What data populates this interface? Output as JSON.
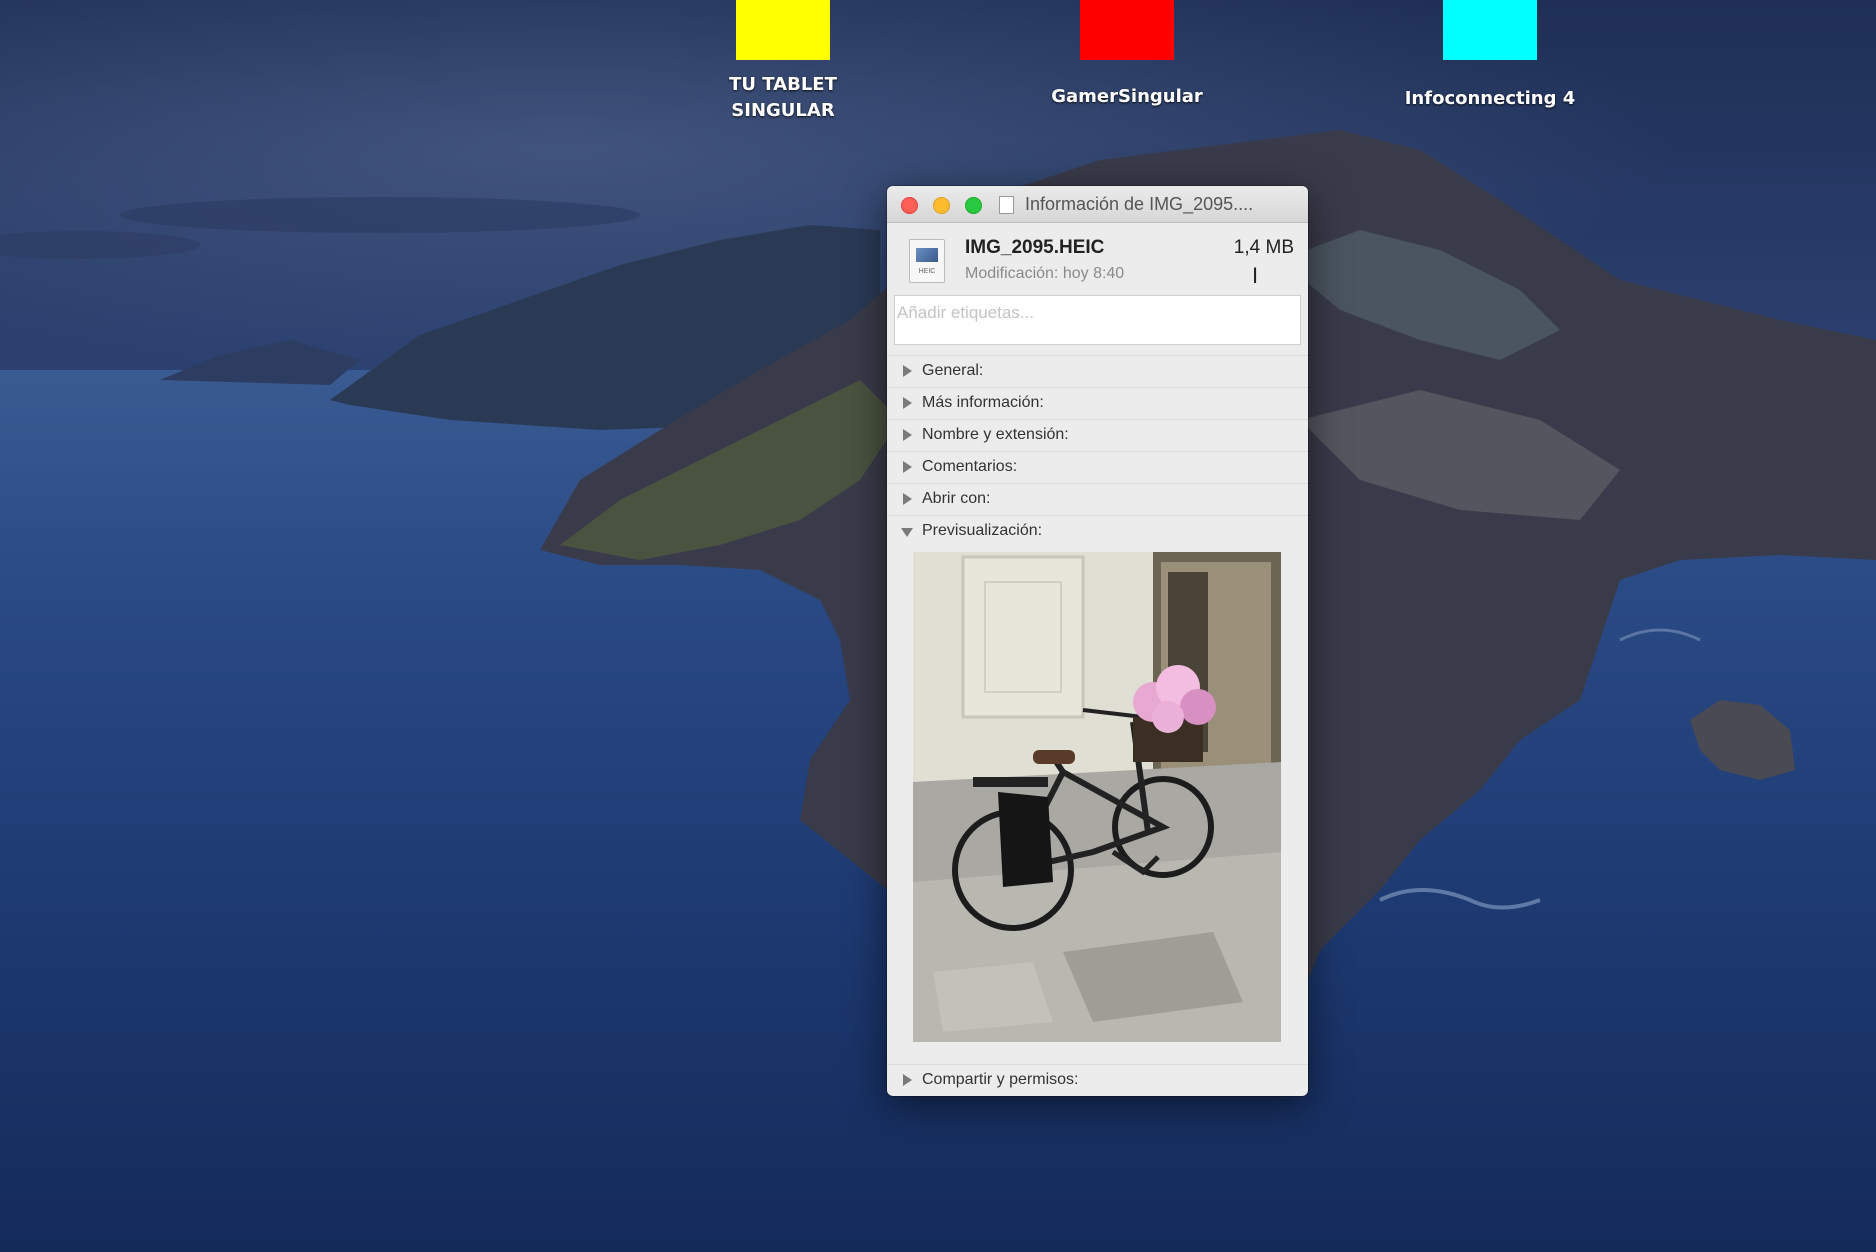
{
  "desktop": {
    "shortcuts": [
      {
        "label": "TU TABLET\nSINGULAR",
        "color": "#ffff00"
      },
      {
        "label": "GamerSingular",
        "color": "#ff0000"
      },
      {
        "label": "Infoconnecting 4",
        "color": "#00ffff"
      }
    ]
  },
  "window": {
    "title": "Información de IMG_2095....",
    "file": {
      "name": "IMG_2095.HEIC",
      "size": "1,4 MB",
      "modified": "Modificación: hoy 8:40",
      "icon_ext": "HEIC"
    },
    "tags_placeholder": "Añadir etiquetas...",
    "sections": [
      {
        "label": "General:",
        "expanded": false
      },
      {
        "label": "Más información:",
        "expanded": false
      },
      {
        "label": "Nombre y extensión:",
        "expanded": false
      },
      {
        "label": "Comentarios:",
        "expanded": false
      },
      {
        "label": "Abrir con:",
        "expanded": false
      },
      {
        "label": "Previsualización:",
        "expanded": true
      }
    ],
    "bottom_section": {
      "label": "Compartir y permisos:",
      "expanded": false
    }
  }
}
